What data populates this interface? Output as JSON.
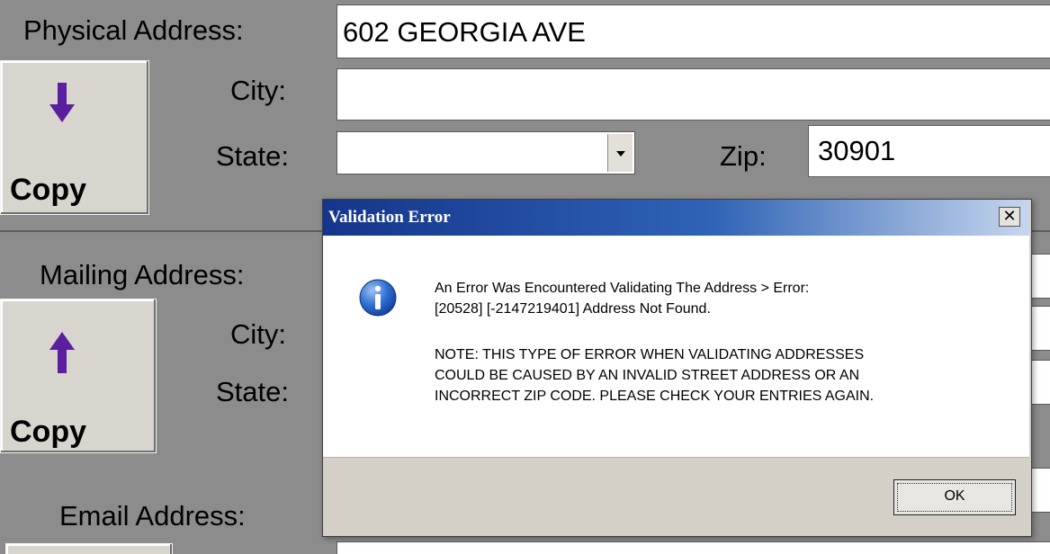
{
  "physical": {
    "label": "Physical Address:",
    "address_value": "602 GEORGIA AVE",
    "city_label": "City:",
    "city_value": "",
    "state_label": "State:",
    "state_value": "",
    "zip_label": "Zip:",
    "zip_value": "30901",
    "copy_label": "Copy",
    "copy_arrow": "down-arrow-icon"
  },
  "mailing": {
    "label": "Mailing Address:",
    "city_label": "City:",
    "state_label": "State:",
    "copy_label": "Copy",
    "copy_arrow": "up-arrow-icon"
  },
  "email": {
    "label": "Email Address:"
  },
  "dialog": {
    "title": "Validation Error",
    "close_label": "✕",
    "icon": "info-icon",
    "message_line1": "An Error Was Encountered Validating The Address > Error:",
    "message_line2": "[20528] [-2147219401] Address Not Found.",
    "note_line1": "NOTE: THIS TYPE OF ERROR WHEN VALIDATING ADDRESSES",
    "note_line2": "COULD BE CAUSED BY AN INVALID STREET ADDRESS OR AN",
    "note_line3": "INCORRECT ZIP CODE. PLEASE CHECK YOUR ENTRIES AGAIN.",
    "ok_label": "OK"
  },
  "colors": {
    "form_background": "#8c8c8c",
    "title_bar_start": "#14358c",
    "title_bar_end": "#c6d6ee",
    "arrow_purple": "#5b1ea0"
  }
}
